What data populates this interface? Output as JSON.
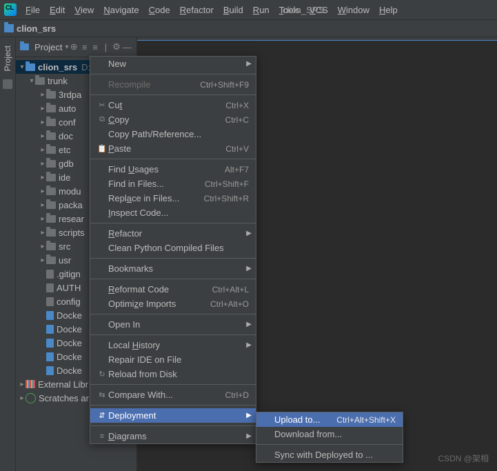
{
  "window_title": "clion_SRS",
  "menubar": [
    "File",
    "Edit",
    "View",
    "Navigate",
    "Code",
    "Refactor",
    "Build",
    "Run",
    "Tools",
    "VCS",
    "Window",
    "Help"
  ],
  "breadcrumb": "clion_srs",
  "panel": {
    "title": "Project"
  },
  "tree": {
    "root": "clion_srs",
    "root_hint": "D:",
    "trunk": "trunk",
    "items": [
      "3rdpa",
      "auto",
      "conf",
      "doc",
      "etc",
      "gdb",
      "ide",
      "modu",
      "packa",
      "resear",
      "scripts",
      "src",
      "usr"
    ],
    "files": [
      ".gitign",
      "AUTH",
      "config",
      "Docke",
      "Docke",
      "Docke",
      "Docke",
      "Docke"
    ],
    "external": "External Libr",
    "scratches": "Scratches ar"
  },
  "context_menu": [
    {
      "type": "item",
      "icon": "",
      "label": "New",
      "shortcut": "",
      "arrow": true
    },
    {
      "type": "sep"
    },
    {
      "type": "item",
      "disabled": true,
      "icon": "",
      "label": "Recompile",
      "shortcut": "Ctrl+Shift+F9"
    },
    {
      "type": "sep"
    },
    {
      "type": "item",
      "icon": "✂",
      "label": "Cut",
      "u": "t",
      "shortcut": "Ctrl+X"
    },
    {
      "type": "item",
      "icon": "⧉",
      "label": "Copy",
      "u": "C",
      "shortcut": "Ctrl+C"
    },
    {
      "type": "item",
      "icon": "",
      "label": "Copy Path/Reference...",
      "shortcut": ""
    },
    {
      "type": "item",
      "icon": "📋",
      "label": "Paste",
      "u": "P",
      "shortcut": "Ctrl+V"
    },
    {
      "type": "sep"
    },
    {
      "type": "item",
      "icon": "",
      "label": "Find Usages",
      "u": "U",
      "shortcut": "Alt+F7"
    },
    {
      "type": "item",
      "icon": "",
      "label": "Find in Files...",
      "shortcut": "Ctrl+Shift+F"
    },
    {
      "type": "item",
      "icon": "",
      "label": "Replace in Files...",
      "u": "a",
      "shortcut": "Ctrl+Shift+R"
    },
    {
      "type": "item",
      "icon": "",
      "label": "Inspect Code...",
      "u": "I",
      "shortcut": ""
    },
    {
      "type": "sep"
    },
    {
      "type": "item",
      "icon": "",
      "label": "Refactor",
      "u": "R",
      "arrow": true
    },
    {
      "type": "item",
      "icon": "",
      "label": "Clean Python Compiled Files",
      "shortcut": ""
    },
    {
      "type": "sep"
    },
    {
      "type": "item",
      "icon": "",
      "label": "Bookmarks",
      "arrow": true
    },
    {
      "type": "sep"
    },
    {
      "type": "item",
      "icon": "",
      "label": "Reformat Code",
      "u": "R",
      "shortcut": "Ctrl+Alt+L"
    },
    {
      "type": "item",
      "icon": "",
      "label": "Optimize Imports",
      "u": "z",
      "shortcut": "Ctrl+Alt+O"
    },
    {
      "type": "sep"
    },
    {
      "type": "item",
      "icon": "",
      "label": "Open In",
      "arrow": true
    },
    {
      "type": "sep"
    },
    {
      "type": "item",
      "icon": "",
      "label": "Local History",
      "u": "H",
      "arrow": true
    },
    {
      "type": "item",
      "icon": "",
      "label": "Repair IDE on File",
      "shortcut": ""
    },
    {
      "type": "item",
      "icon": "↻",
      "label": "Reload from Disk",
      "shortcut": ""
    },
    {
      "type": "sep"
    },
    {
      "type": "item",
      "icon": "⇆",
      "label": "Compare With...",
      "shortcut": "Ctrl+D"
    },
    {
      "type": "sep"
    },
    {
      "type": "item",
      "icon": "⇵",
      "label": "Deployment",
      "hover": true,
      "arrow": true
    },
    {
      "type": "sep"
    },
    {
      "type": "item",
      "icon": "≡",
      "label": "Diagrams",
      "u": "D",
      "arrow": true
    }
  ],
  "submenu": [
    {
      "label": "Upload to...",
      "shortcut": "Ctrl+Alt+Shift+X",
      "hover": true
    },
    {
      "label": "Download from...",
      "shortcut": ""
    },
    {
      "sep": true
    },
    {
      "label": "Sync with Deployed to ...",
      "shortcut": ""
    }
  ],
  "watermark": "CSDN @架相"
}
